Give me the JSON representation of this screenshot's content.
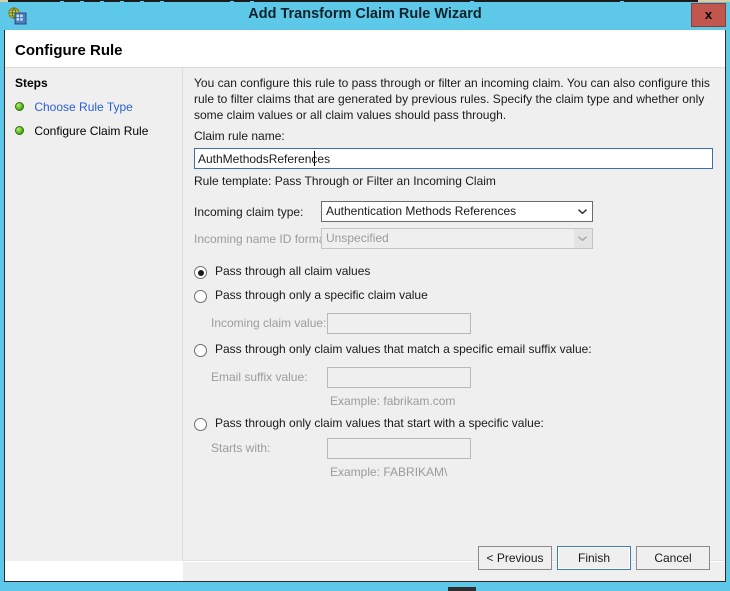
{
  "window": {
    "title": "Add Transform Claim Rule Wizard",
    "app_icon": "network-certificate-icon",
    "close_label": "x",
    "chrome_color": "#5ec8e8",
    "close_button_color": "#c0564e"
  },
  "header": {
    "page_title": "Configure Rule"
  },
  "sidebar": {
    "heading": "Steps",
    "items": [
      {
        "label": "Choose Rule Type",
        "state": "completed-link",
        "bullet": "green-bullet-icon"
      },
      {
        "label": "Configure Claim Rule",
        "state": "current",
        "bullet": "green-bullet-icon"
      }
    ]
  },
  "main": {
    "intro": "You can configure this rule to pass through or filter an incoming claim. You can also configure this rule to filter claims that are generated by previous rules. Specify the claim type and whether only some claim values or all claim values should pass through.",
    "rule_name": {
      "label": "Claim rule name:",
      "value": "AuthMethodsReferences",
      "placeholder": "",
      "focused": true
    },
    "rule_template": "Rule template: Pass Through or Filter an Incoming Claim",
    "incoming_claim_type": {
      "label": "Incoming claim type:",
      "value": "Authentication Methods References",
      "enabled": true,
      "arrow_icon": "chevron-down-icon"
    },
    "incoming_name_id_format": {
      "label": "Incoming name ID format:",
      "value": "Unspecified",
      "enabled": false,
      "arrow_icon": "chevron-down-icon"
    },
    "options": [
      {
        "label": "Pass through all claim values",
        "selected": true
      },
      {
        "label": "Pass through only a specific claim value",
        "selected": false,
        "field_label": "Incoming claim value:",
        "field_value": "",
        "field_enabled": false
      },
      {
        "label": "Pass through only claim values that match a specific email suffix value:",
        "selected": false,
        "field_label": "Email suffix value:",
        "field_value": "",
        "field_enabled": false,
        "example": "Example: fabrikam.com"
      },
      {
        "label": "Pass through only claim values that start with a specific value:",
        "selected": false,
        "field_label": "Starts with:",
        "field_value": "",
        "field_enabled": false,
        "example": "Example: FABRIKAM\\"
      }
    ]
  },
  "buttons": {
    "previous": "< Previous",
    "finish": "Finish",
    "cancel": "Cancel",
    "default_button": "Finish"
  }
}
